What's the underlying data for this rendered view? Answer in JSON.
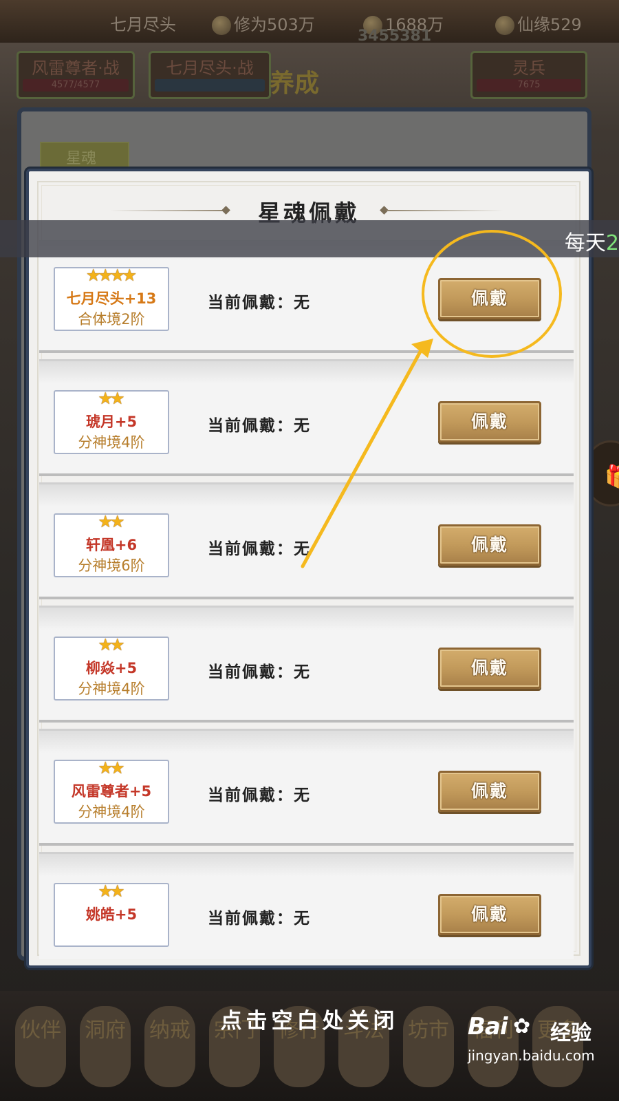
{
  "background": {
    "top_bar": {
      "title_mark": "",
      "player_name": "七月尽头",
      "cultivation_label": "修为",
      "cultivation_value": "503万",
      "power_value": "1688万",
      "fate_label": "仙缘",
      "fate_value": "529",
      "overlay_number": "3455381"
    },
    "tabs": [
      {
        "label": "风雷尊者·战",
        "bar": "4577/4577"
      },
      {
        "label": "七月尽头·战",
        "bar": ""
      },
      {
        "label": "灵兵",
        "bar": "7675"
      }
    ],
    "center_title": "养成",
    "panel_button": "星魂",
    "bottom_nav": [
      "伙伴",
      "洞府",
      "纳戒",
      "宗门",
      "修行",
      "斗法",
      "坊市",
      "福利",
      "更多"
    ]
  },
  "modal": {
    "title": "星魂佩戴",
    "current_label": "当前佩戴：",
    "current_value": "无",
    "equip_label": "佩戴",
    "rows": [
      {
        "stars": 4,
        "name": "七月尽头+13",
        "rank": "合体境2阶",
        "name_color": "orange"
      },
      {
        "stars": 2,
        "name": "琥月+5",
        "rank": "分神境4阶",
        "name_color": "red"
      },
      {
        "stars": 2,
        "name": "轩凰+6",
        "rank": "分神境6阶",
        "name_color": "red"
      },
      {
        "stars": 2,
        "name": "柳焱+5",
        "rank": "分神境4阶",
        "name_color": "red"
      },
      {
        "stars": 2,
        "name": "风雷尊者+5",
        "rank": "分神境4阶",
        "name_color": "red"
      },
      {
        "stars": 2,
        "name": "姚皓+5",
        "rank": "",
        "name_color": "red"
      }
    ]
  },
  "notice": {
    "prefix": "每天",
    "number": "2"
  },
  "close_hint": "点击空白处关闭",
  "watermark": {
    "brand": "Bai",
    "brand_suffix": "经验",
    "url": "jingyan.baidu.com"
  },
  "colors": {
    "accent_gold": "#f5b91e",
    "name_red": "#c43728",
    "name_orange": "#d67917",
    "button_gold": "#c29a5b"
  },
  "icons": {
    "star": "star-icon",
    "gift": "gift-icon",
    "arrow": "arrow-annotation",
    "circle": "circle-annotation"
  }
}
